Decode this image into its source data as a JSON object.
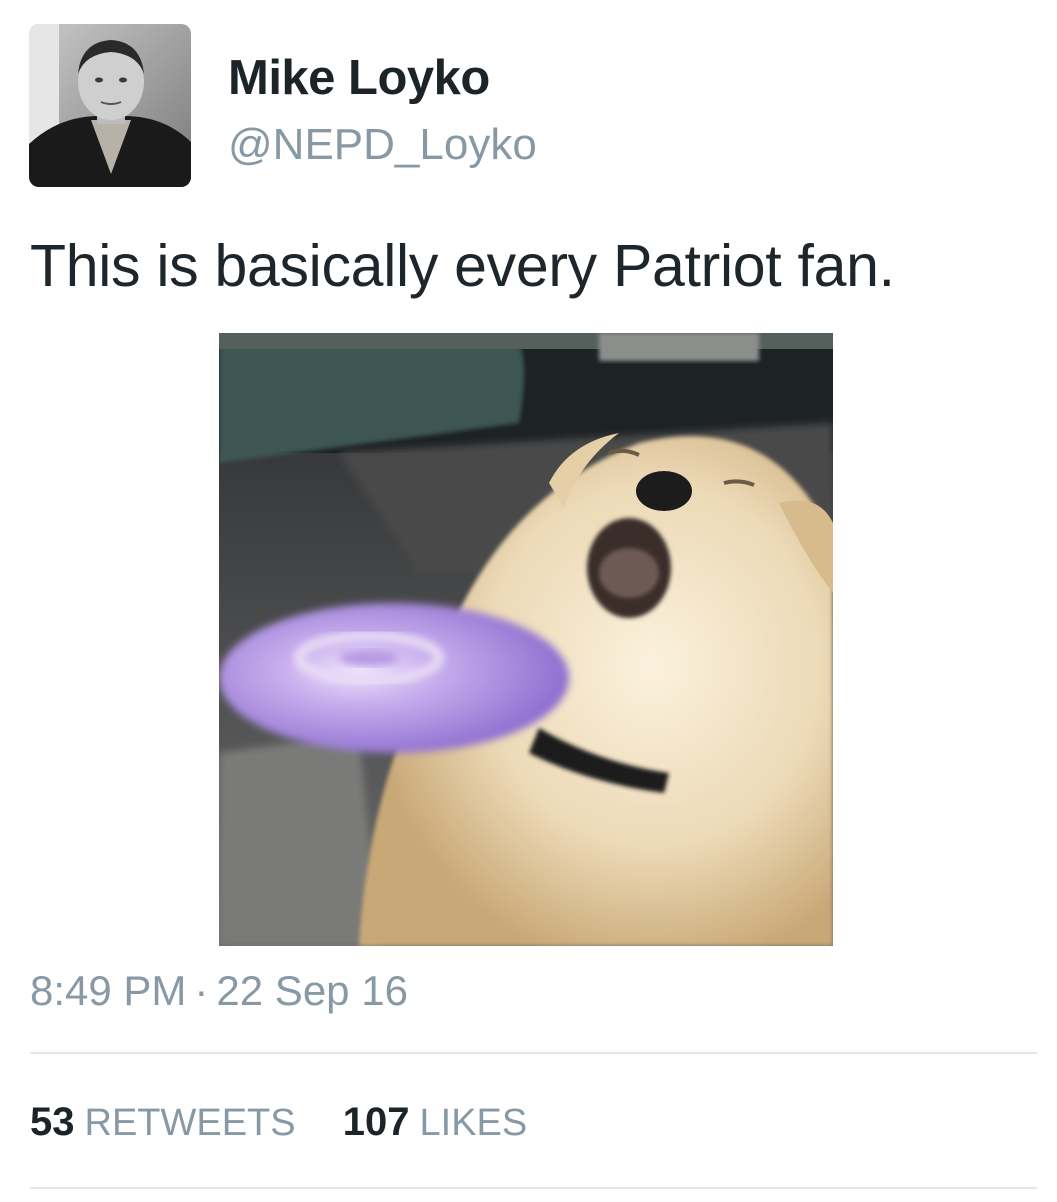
{
  "author": {
    "display_name": "Mike Loyko",
    "handle": "@NEPD_Loyko"
  },
  "tweet": {
    "text": "This is basically every Patriot fan.",
    "time": "8:49 PM",
    "separator": "·",
    "date": "22 Sep 16"
  },
  "stats": {
    "retweets_count": "53",
    "retweets_label": "RETWEETS",
    "likes_count": "107",
    "likes_label": "LIKES"
  },
  "colors": {
    "name": "#1c2428",
    "secondary_text": "#8899a6",
    "divider": "#e1e8ed",
    "frisbee": "#a98be0"
  }
}
